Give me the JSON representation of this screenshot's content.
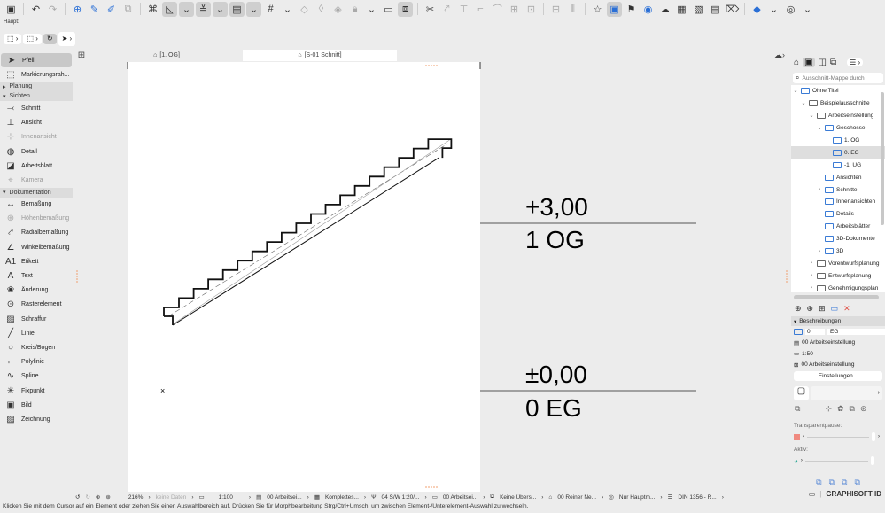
{
  "toolbar": {
    "label": "Haupt:"
  },
  "tabs": [
    {
      "label": "[1. OG]"
    },
    {
      "label": "[S-01 Schnitt]"
    }
  ],
  "toolbox": {
    "items_top": [
      {
        "label": "Pfeil",
        "icon": "arrow-icon"
      },
      {
        "label": "Markierungsrah...",
        "icon": "marquee-icon"
      }
    ],
    "groups": {
      "planung": "Planung",
      "sichten": "Sichten",
      "dokumentation": "Dokumentation"
    },
    "sichten": [
      {
        "label": "Schnitt"
      },
      {
        "label": "Ansicht"
      },
      {
        "label": "Innenansicht"
      },
      {
        "label": "Detail"
      },
      {
        "label": "Arbeitsblatt"
      },
      {
        "label": "Kamera"
      }
    ],
    "dokumentation": [
      {
        "label": "Bemaßung"
      },
      {
        "label": "Höhenbemaßung"
      },
      {
        "label": "Radialbemaßung"
      },
      {
        "label": "Winkelbemaßung"
      },
      {
        "label": "Etikett"
      },
      {
        "label": "Text"
      },
      {
        "label": "Änderung"
      },
      {
        "label": "Rasterelement"
      },
      {
        "label": "Schraffur"
      },
      {
        "label": "Linie"
      },
      {
        "label": "Kreis/Bogen"
      },
      {
        "label": "Polylinie"
      },
      {
        "label": "Spline"
      },
      {
        "label": "Fixpunkt"
      },
      {
        "label": "Bild"
      },
      {
        "label": "Zeichnung"
      }
    ]
  },
  "drawing": {
    "level1_value": "+3,00",
    "level1_name": "1 OG",
    "level0_value": "±0,00",
    "level0_name": "0 EG"
  },
  "navigator": {
    "search_placeholder": "Ausschnitt-Mappe durch",
    "tree": [
      {
        "label": "Ohne Titel",
        "depth": 0,
        "open": "v"
      },
      {
        "label": "Beispielausschnitte",
        "depth": 1,
        "open": "v"
      },
      {
        "label": "Arbeitseinstellung",
        "depth": 2,
        "open": "v"
      },
      {
        "label": "Geschosse",
        "depth": 3,
        "open": "v"
      },
      {
        "label": "1. OG",
        "depth": 4,
        "open": ""
      },
      {
        "label": "0. EG",
        "depth": 4,
        "open": "",
        "selected": true
      },
      {
        "label": "-1. UG",
        "depth": 4,
        "open": ""
      },
      {
        "label": "Ansichten",
        "depth": 3,
        "open": ""
      },
      {
        "label": "Schnitte",
        "depth": 3,
        "open": ">"
      },
      {
        "label": "Innenansichten",
        "depth": 3,
        "open": ""
      },
      {
        "label": "Details",
        "depth": 3,
        "open": ""
      },
      {
        "label": "Arbeitsblätter",
        "depth": 3,
        "open": ""
      },
      {
        "label": "3D-Dokumente",
        "depth": 3,
        "open": ""
      },
      {
        "label": "3D",
        "depth": 3,
        "open": ">"
      },
      {
        "label": "Vorentwurfsplanung",
        "depth": 2,
        "open": ">"
      },
      {
        "label": "Entwurfsplanung",
        "depth": 2,
        "open": ">"
      },
      {
        "label": "Genehmigungsplan",
        "depth": 2,
        "open": ">"
      }
    ]
  },
  "properties": {
    "header": "Beschreibungen",
    "id": "0.",
    "name": "EG",
    "layer_combo": "00 Arbeitseinstellung",
    "scale": "1:50",
    "model_view": "00 Arbeitseinstellung",
    "settings_button": "Einstellungen...",
    "transparent_label": "Transparentpause:",
    "active_label": "Aktiv:",
    "trace_color": "#f08a80"
  },
  "statusbar": {
    "zoom": "216%",
    "undo_data": "keine Daten",
    "scale": "1:100",
    "layer": "00 Arbeitsei...",
    "structure": "Komplettes...",
    "pen": "04 S/W 1:20/...",
    "model": "00 Arbeitsei...",
    "overrides": "Keine Übers...",
    "renovation": "00 Reiner Ne...",
    "structure_display": "Nur Hauptm...",
    "dim": "DIN 1356 - R..."
  },
  "message": "Klicken Sie mit dem Cursor auf ein Element oder ziehen Sie einen Auswahlbereich auf. Drücken Sie für Morphbearbeitung Strg/Ctrl+Umsch, um zwischen Element-/Unterelement-Auswahl zu wechseln.",
  "brand": "GRAPHISOFT ID"
}
